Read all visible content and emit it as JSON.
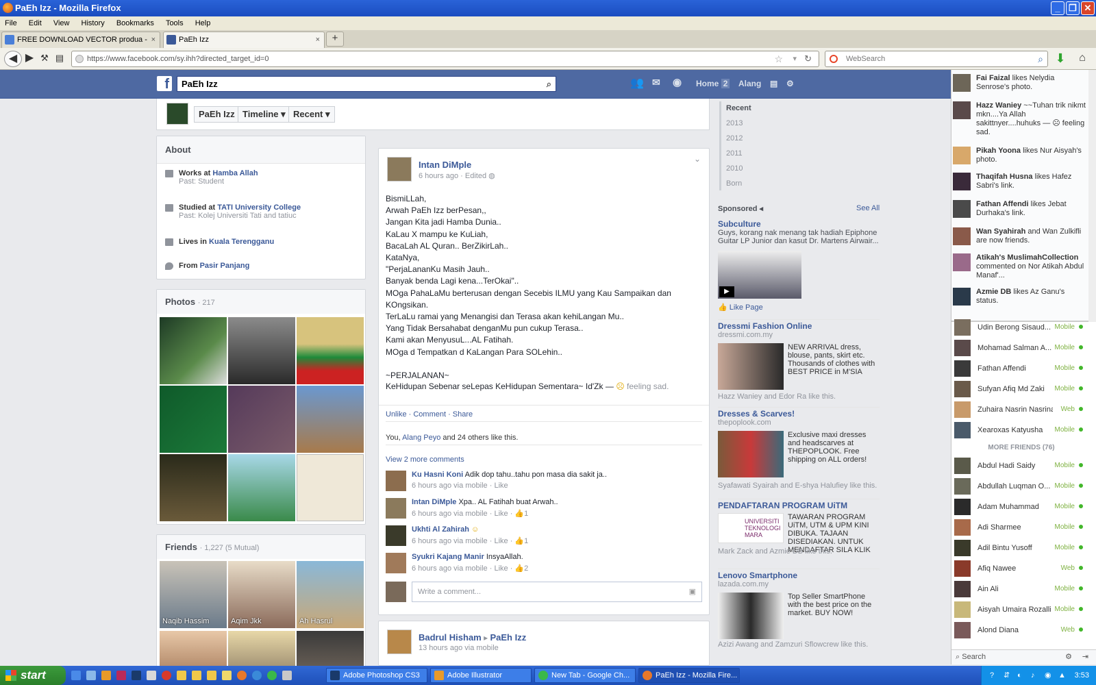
{
  "window": {
    "title": "PaEh Izz - Mozilla Firefox",
    "min": "_",
    "max": "❐",
    "close": "✕"
  },
  "menu": [
    "File",
    "Edit",
    "View",
    "History",
    "Bookmarks",
    "Tools",
    "Help"
  ],
  "tabs": [
    {
      "label": "FREE DOWNLOAD VECTOR produa - Goo...",
      "close": "×"
    },
    {
      "label": "PaEh Izz",
      "close": "×"
    }
  ],
  "new_tab": "+",
  "nav": {
    "url": "https://www.facebook.com/sy.ihh?directed_target_id=0",
    "search_placeholder": "WebSearch"
  },
  "fb": {
    "logo": "f",
    "search_value": "PaEh Izz",
    "home_label": "Home",
    "home_count": "2",
    "user_label": "Alang"
  },
  "timeline_bar": {
    "name": "PaEh Izz",
    "timeline": "Timeline",
    "recent": "Recent"
  },
  "about": {
    "title": "About",
    "works_prefix": "Works at",
    "works": "Hamba Allah",
    "works_past": "Past: Student",
    "studied_prefix": "Studied at",
    "studied": "TATI University College",
    "studied_past": "Past: Kolej Universiti Tati and tatiuc",
    "lives_prefix": "Lives in",
    "lives": "Kuala Terengganu",
    "from_prefix": "From",
    "from": "Pasir Panjang"
  },
  "photos": {
    "title": "Photos",
    "count": "· 217"
  },
  "friends": {
    "title": "Friends",
    "count": "· 1,227 (5 Mutual)",
    "names": [
      "Naqib Hassim",
      "Aqim Jkk",
      "Ah Hasrul"
    ]
  },
  "post": {
    "author": "Intan DiMple",
    "meta": "6 hours ago · Edited",
    "text": "BismiLLah,\nArwah PaEh Izz berPesan,,\nJangan Kita jadi Hamba Dunia..\nKaLau X mampu ke KuLiah,\nBacaLah AL Quran.. BerZikirLah..\nKataNya,\n\"PerjaLananKu Masih Jauh..\nBanyak benda Lagi kena...TerOkai\"..\nMOga PahaLaMu berterusan dengan Secebis ILMU yang Kau Sampaikan dan\nKOngsikan.\nTerLaLu ramai yang Menangisi dan Terasa akan kehiLangan Mu..\nYang Tidak Bersahabat denganMu pun cukup Terasa..\nKami akan MenyusuL...AL Fatihah.\nMOga d Tempatkan d KaLangan Para SOLehin..\n\n~PERJALANAN~",
    "last_line": "KeHidupan Sebenar seLepas KeHidupan Sementara~ Id'Zk —",
    "feeling": "feeling sad.",
    "actions": "Unlike · Comment · Share",
    "likes_prefix": "You,",
    "likes_link": "Alang Peyo",
    "likes_suffix": "and 24 others like this.",
    "view_more": "View 2 more comments",
    "comments": [
      {
        "name": "Ku Hasni Koni",
        "text": "Adik dop tahu..tahu pon masa dia sakit ja..",
        "meta": "6 hours ago via mobile · Like"
      },
      {
        "name": "Intan DiMple",
        "text": "Xpa.. AL Fatihah buat Arwah..",
        "meta": "6 hours ago via mobile · Like · 👍1"
      },
      {
        "name": "Ukhti Al Zahirah",
        "text": "☺",
        "meta": "6 hours ago via mobile · Like · 👍1"
      },
      {
        "name": "Syukri Kajang Manir",
        "text": "InsyaAllah.",
        "meta": "6 hours ago via mobile · Like · 👍2"
      }
    ],
    "comment_placeholder": "Write a comment..."
  },
  "post2": {
    "author": "Badrul Hisham",
    "target": "PaEh Izz",
    "meta": "13 hours ago via mobile"
  },
  "years": [
    "Recent",
    "2013",
    "2012",
    "2011",
    "2010",
    "Born"
  ],
  "sponsored": {
    "title": "Sponsored",
    "see_all": "See All",
    "ads": [
      {
        "title": "Subculture",
        "body": "Guys, korang nak menang tak hadiah Epiphone Guitar LP Junior dan kasut Dr. Martens Airwair...",
        "action": "Like Page"
      },
      {
        "title": "Dressmi Fashion Online",
        "domain": "dressmi.com.my",
        "body": "NEW ARRIVAL dress, blouse, pants, skirt etc. Thousands of clothes with BEST PRICE in M'SIA",
        "social": "Hazz Waniey and Edor Ra like this."
      },
      {
        "title": "Dresses & Scarves!",
        "domain": "thepoplook.com",
        "body": "Exclusive maxi dresses and headscarves at THEPOPLOOK. Free shipping on ALL orders!",
        "social": "Syafawati Syairah and E-shya Halufiey like this."
      },
      {
        "title": "PENDAFTARAN PROGRAM UiTM",
        "body": "TAWARAN PROGRAM UiTM, UTM & UPM KINI DIBUKA. TAJAAN DISEDIAKAN. UNTUK MENDAFTAR SILA KLIK",
        "social": "Mark Zack and Azmie DB like this."
      },
      {
        "title": "Lenovo Smartphone",
        "domain": "lazada.com.my",
        "body": "Top Seller SmartPhone with the best price on the market. BUY NOW!",
        "social": "Azizi Awang and Zamzuri Sflowcrew like this."
      }
    ]
  },
  "ticker": [
    {
      "name": "Fai Faizal",
      "text": "likes Nelydia Senrose's photo."
    },
    {
      "name": "Hazz Waniey",
      "text": "~~Tuhan trik nikmt mkn....Ya Allah sakittnyer....huhuks — ☹ feeling sad."
    },
    {
      "name": "Pikah Yoona",
      "text": "likes Nur Aisyah's photo."
    },
    {
      "name": "Thaqifah Husna",
      "text": "likes Hafez Sabri's link."
    },
    {
      "name": "Fathan Affendi",
      "text": "likes Jebat Durhaka's link."
    },
    {
      "name": "Wan Syahirah",
      "text": "and Wan Zulkifli are now friends."
    },
    {
      "name": "Atikah's MuslimahCollection",
      "text": "commented on Nor Atikah Abdul Manaf'..."
    },
    {
      "name": "Azmie DB",
      "text": "likes Az Ganu's status."
    }
  ],
  "chat": {
    "online": [
      {
        "name": "Udin Berong Sisaud...",
        "status": "Mobile"
      },
      {
        "name": "Mohamad Salman A...",
        "status": "Mobile"
      },
      {
        "name": "Fathan Affendi",
        "status": "Mobile"
      },
      {
        "name": "Sufyan Afiq Md Zaki",
        "status": "Mobile"
      },
      {
        "name": "Zuhaira Nasrin Nasrina",
        "status": "Web"
      },
      {
        "name": "Xearoxas Katyusha",
        "status": "Mobile"
      }
    ],
    "more_label": "MORE FRIENDS (76)",
    "more": [
      {
        "name": "Abdul Hadi Saidy",
        "status": "Mobile"
      },
      {
        "name": "Abdullah Luqman O...",
        "status": "Mobile"
      },
      {
        "name": "Adam Muhammad",
        "status": "Mobile"
      },
      {
        "name": "Adi Sharmee",
        "status": "Mobile"
      },
      {
        "name": "Adil Bintu Yusoff",
        "status": "Mobile"
      },
      {
        "name": "Afiq Nawee",
        "status": "Web"
      },
      {
        "name": "Ain Ali",
        "status": "Mobile"
      },
      {
        "name": "Aisyah Umaira Rozalli",
        "status": "Mobile"
      },
      {
        "name": "Alond Diana",
        "status": "Web"
      }
    ],
    "search_placeholder": "Search"
  },
  "taskbar": {
    "start": "start",
    "tasks": [
      "Adobe Photoshop CS3",
      "Adobe Illustrator",
      "New Tab - Google Ch...",
      "PaEh Izz - Mozilla Fire..."
    ],
    "clock": "3:53"
  }
}
